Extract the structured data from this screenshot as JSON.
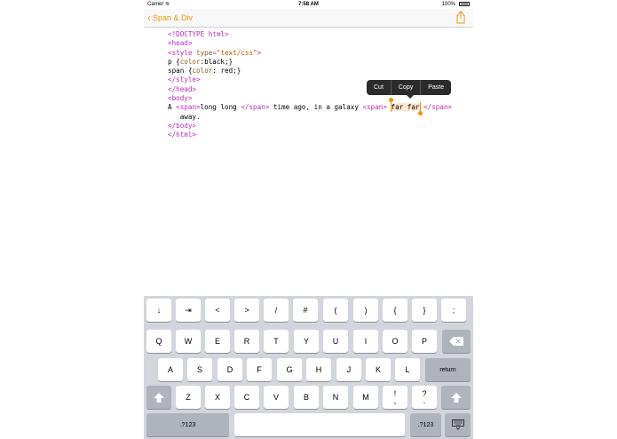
{
  "status_bar": {
    "carrier": "Carrier",
    "time": "7:58 AM",
    "battery": "100%"
  },
  "nav": {
    "back_label": "Span & Div",
    "share_icon": "share-icon"
  },
  "editor": {
    "lines": {
      "l1": "<!DOCTYPE html>",
      "l2": "<head>",
      "l3_open": "<style ",
      "l3_attr": "type",
      "l3_eq": "=",
      "l3_val": "\"text/css\"",
      "l3_close": ">",
      "l4_sel": "p {",
      "l4_prop": "color",
      "l4_rest": ":black;}",
      "l5_sel": "span {",
      "l5_prop": "color",
      "l5_rest": ": red;}",
      "l6": "</style>",
      "l7": "</head>",
      "l8": "<body>",
      "l9_a": "A ",
      "l9_tag1": "<span>",
      "l9_b": "long long ",
      "l9_tag2": "</span>",
      "l9_c": " time ago, in a galaxy ",
      "l9_tag3": "<span>",
      "l9_sp": " ",
      "l9_sel": "far far",
      "l9_sp2": " ",
      "l9_tag4": "</span>",
      "l10": "   away.",
      "l11": "</body>",
      "l12": "</html>"
    }
  },
  "edit_menu": {
    "cut": "Cut",
    "copy": "Copy",
    "paste": "Paste"
  },
  "keyboard": {
    "row0": [
      "↓",
      "⇥",
      "<",
      ">",
      "/",
      "#",
      "(",
      ")",
      "{",
      "}",
      ";"
    ],
    "row1": [
      "Q",
      "W",
      "E",
      "R",
      "T",
      "Y",
      "U",
      "I",
      "O",
      "P"
    ],
    "row2": [
      "A",
      "S",
      "D",
      "F",
      "G",
      "H",
      "J",
      "K",
      "L"
    ],
    "row3": [
      "Z",
      "X",
      "C",
      "V",
      "B",
      "N",
      "M"
    ],
    "exclaim_top": "!",
    "exclaim_bot": ",",
    "question_top": "?",
    "question_bot": ".",
    "return": "return",
    "numbers": ".?123"
  }
}
